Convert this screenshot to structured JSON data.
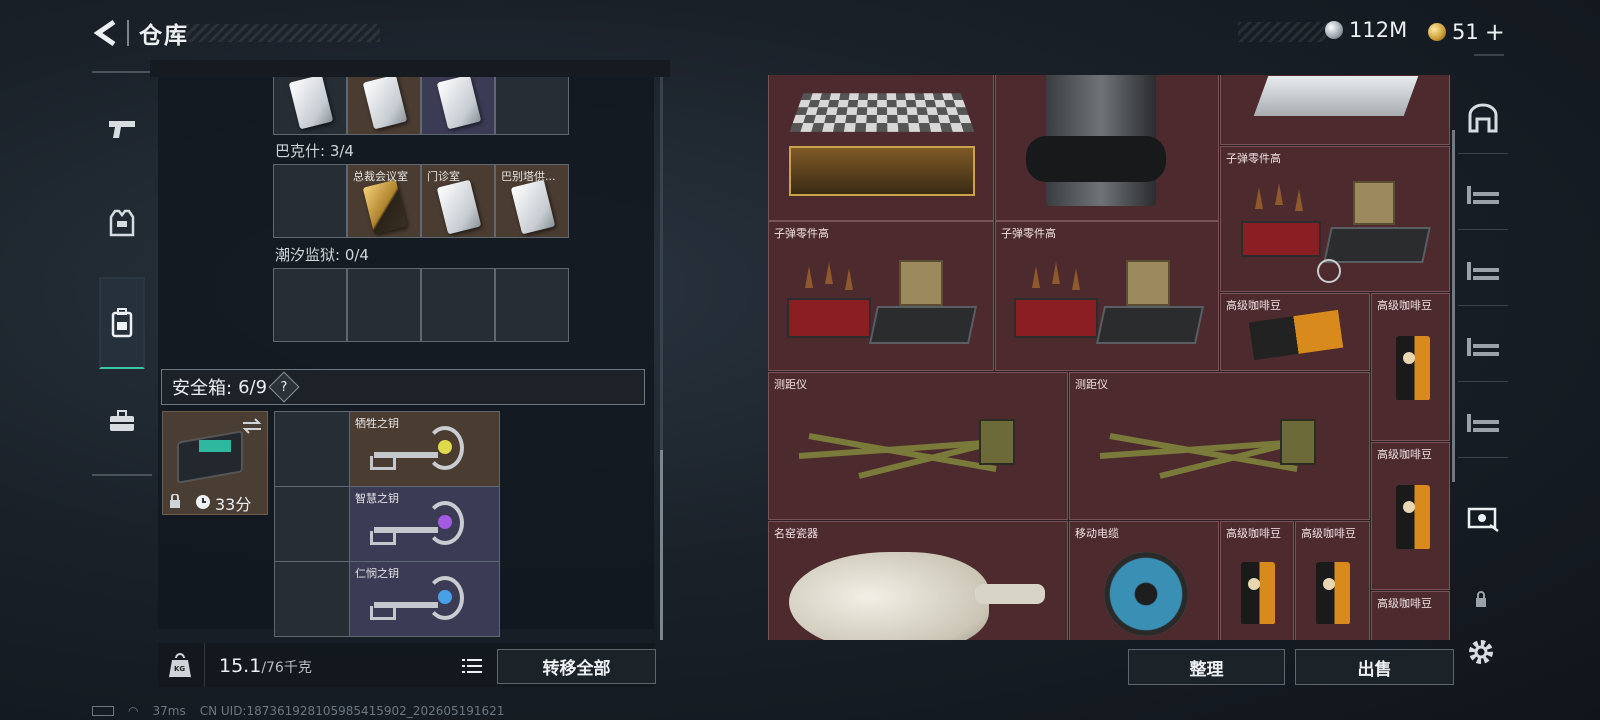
{
  "header": {
    "title": "仓库",
    "back_label": "back"
  },
  "currency": [
    {
      "name": "silver",
      "value": "112M"
    },
    {
      "name": "gold",
      "value": "51",
      "plus": "+"
    }
  ],
  "left_rail": [
    "weapon",
    "armor",
    "backpack",
    "briefcase"
  ],
  "key_groups": [
    {
      "label": "",
      "slots": [
        "",
        "",
        "",
        ""
      ]
    },
    {
      "label": "巴克什: 3/4",
      "slots": [
        "总裁会议室",
        "门诊室",
        "巴别塔供...",
        ""
      ]
    },
    {
      "label": "潮汐监狱: 0/4",
      "slots": [
        "",
        "",
        "",
        ""
      ]
    }
  ],
  "safebox": {
    "label": "安全箱:",
    "count": "6/9",
    "help": "?",
    "timer": "33分",
    "keys": [
      {
        "name": "牺牲之钥",
        "gem": "#e0d94a"
      },
      {
        "name": "智慧之钥",
        "gem": "#a35be0"
      },
      {
        "name": "仁悯之钥",
        "gem": "#4aa0e8"
      }
    ]
  },
  "weight": {
    "current": "15.1",
    "max": "/76千克",
    "icon_label": "KG"
  },
  "transfer_all": "转移全部",
  "stash_items": {
    "ammo1": "子弹零件高",
    "ammo2": "子弹零件高",
    "ammo3": "子弹零件高",
    "coffee1": "高级咖啡豆",
    "coffee2": "高级咖啡豆",
    "coffee3": "高级咖啡豆",
    "coffee4": "高级咖啡豆",
    "coffee5": "高级咖啡豆",
    "coffee6": "高级咖啡豆",
    "rangefinder1": "测距仪",
    "rangefinder2": "测距仪",
    "porcelain": "名窑瓷器",
    "cable": "移动电缆"
  },
  "buttons": {
    "sort": "整理",
    "sell": "出售"
  },
  "status": {
    "ping": "37ms",
    "uid": "CN UID:18736192810598541590​2_202605191621"
  },
  "colors": {
    "accent": "#39c6a4",
    "stash_tile": "#4d2a2e"
  }
}
